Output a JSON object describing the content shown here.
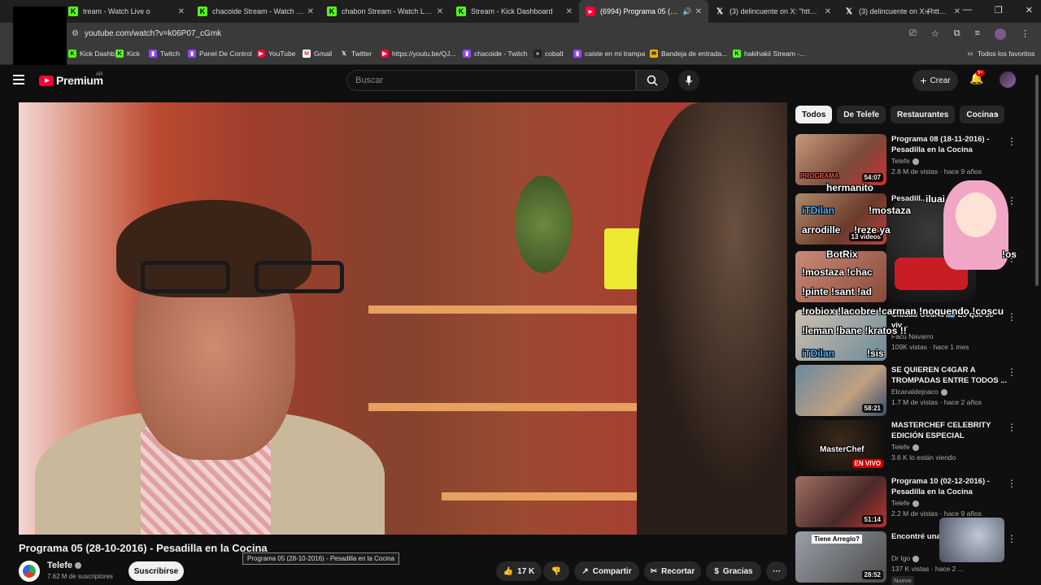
{
  "browser": {
    "tabs": [
      {
        "title": "tream - Watch Live o",
        "icon": "kick-icon",
        "active": false
      },
      {
        "title": "chacoide Stream - Watch Live o",
        "icon": "kick-icon",
        "active": false
      },
      {
        "title": "chabon Stream - Watch Live o",
        "icon": "kick-icon",
        "active": false
      },
      {
        "title": "Stream - Kick Dashboard",
        "icon": "kick-icon",
        "active": false
      },
      {
        "title": "(6994) Programa 05 (28-10",
        "icon": "youtube-icon",
        "active": true
      },
      {
        "title": "(3) delincuente on X: \"https://t",
        "icon": "x-icon",
        "active": false
      },
      {
        "title": "(3) delincuente on X: \"https://t",
        "icon": "x-icon",
        "active": false
      }
    ],
    "url": "youtube.com/watch?v=k06P07_cGmk",
    "bookmarks": [
      {
        "label": "Kick Dashb...",
        "icon": "k"
      },
      {
        "label": "Kick",
        "icon": "k"
      },
      {
        "label": "Twitch",
        "icon": "tw"
      },
      {
        "label": "Panel De Control",
        "icon": "tw"
      },
      {
        "label": "YouTube",
        "icon": "yt"
      },
      {
        "label": "Gmail",
        "icon": "gm"
      },
      {
        "label": "Twitter",
        "icon": "x"
      },
      {
        "label": "https://youtu.be/QJ...",
        "icon": "yt"
      },
      {
        "label": "chacoide - Twitch",
        "icon": "tw"
      },
      {
        "label": "cobalt",
        "icon": "cb"
      },
      {
        "label": "caiste en mi trampa",
        "icon": "tw"
      },
      {
        "label": "Bandeja de entrada...",
        "icon": "mail"
      },
      {
        "label": "hakihakii Stream -...",
        "icon": "k"
      }
    ],
    "all_bookmarks": "Todos los favoritos"
  },
  "header": {
    "logo_text": "Premium",
    "region": "AR",
    "search_placeholder": "Buscar",
    "create_label": "Crear",
    "notifications_badge": "9+"
  },
  "video": {
    "title": "Programa 05 (28-10-2016) - Pesadilla en la Cocina",
    "tooltip": "Programa 05 (28-10-2016) - Pesadilla en la Cocina",
    "channel": "Telefe",
    "subscribers": "7.62 M de suscriptores",
    "subscribe_label": "Suscribirse",
    "likes": "17 K",
    "share_label": "Compartir",
    "clip_label": "Recortar",
    "thanks_label": "Gracias",
    "more_label": "···"
  },
  "sidebar": {
    "chips": [
      "Todos",
      "De Telefe",
      "Restaurantes",
      "Cocinas"
    ],
    "recommendations": [
      {
        "title": "Programa 08 (18-11-2016) - Pesadilla en la Cocina",
        "channel": "Telefe",
        "meta": "2.8 M de vistas · hace 9 años",
        "duration": "54:07",
        "verified": true
      },
      {
        "title": "Pesadill...",
        "channel": "Juan P...",
        "meta": "",
        "duration": "13 videos",
        "verified": false
      },
      {
        "title": "",
        "channel": "",
        "meta": "",
        "duration": "",
        "verified": false
      },
      {
        "title": "Ciudad Oculta 🇦🇷 Lo que se viv...",
        "channel": "Facu Navarro",
        "meta": "109K vistas · hace 1 mes",
        "duration": "",
        "verified": false
      },
      {
        "title": "SE QUIEREN C4GAR A TROMPADAS ENTRE TODOS ...",
        "channel": "Elcanaldejoaco",
        "meta": "1.7 M de vistas · hace 2 años",
        "duration": "58:21",
        "verified": true
      },
      {
        "title": "MASTERCHEF CELEBRITY EDICIÓN ESPECIAL",
        "channel": "Telefe",
        "meta": "3.6 K lo están viendo",
        "duration": "EN VIVO",
        "verified": true
      },
      {
        "title": "Programa 10 (02-12-2016) - Pesadilla en la Cocina",
        "channel": "Telefe",
        "meta": "2.2 M de vistas · hace 9 años",
        "duration": "51:14",
        "verified": true
      },
      {
        "title": "Encontré una ... reparar",
        "channel": "Dr Igo",
        "meta": "137 K vistas · hace 2 ...",
        "duration": "28:52",
        "verified": true,
        "badge": "Nuevo"
      }
    ]
  },
  "stream_overlay": [
    {
      "text": "hermanito",
      "color": "white"
    },
    {
      "text": "iTDilan",
      "color": "blue"
    },
    {
      "text": "!mostaza",
      "color": "white"
    },
    {
      "text": "arrodille",
      "color": "white"
    },
    {
      "text": "!reze ya",
      "color": "white"
    },
    {
      "text": "BotRix",
      "color": "white"
    },
    {
      "text": "!mostaza !chac",
      "color": "white"
    },
    {
      "text": "!pinte !sant !ad",
      "color": "white"
    },
    {
      "text": "!robiox !lacobre !carman !noquendo !coscu",
      "color": "white"
    },
    {
      "text": "!leman !bane !kratos !!",
      "color": "white"
    },
    {
      "text": "iTDilan",
      "color": "blue"
    },
    {
      "text": "!sis",
      "color": "white"
    },
    {
      "text": "Tiene Arreglo?",
      "color": "white"
    },
    {
      "text": "MasterChef",
      "color": "white"
    },
    {
      "text": "PROGRAMA",
      "color": "white"
    },
    {
      "text": "iluai",
      "color": "white"
    },
    {
      "text": "!os",
      "color": "white"
    }
  ],
  "colors": {
    "youtube_red": "#ff0033",
    "kick_green": "#53fc18",
    "twitch_purple": "#9146ff",
    "bg": "#0f0f0f"
  }
}
